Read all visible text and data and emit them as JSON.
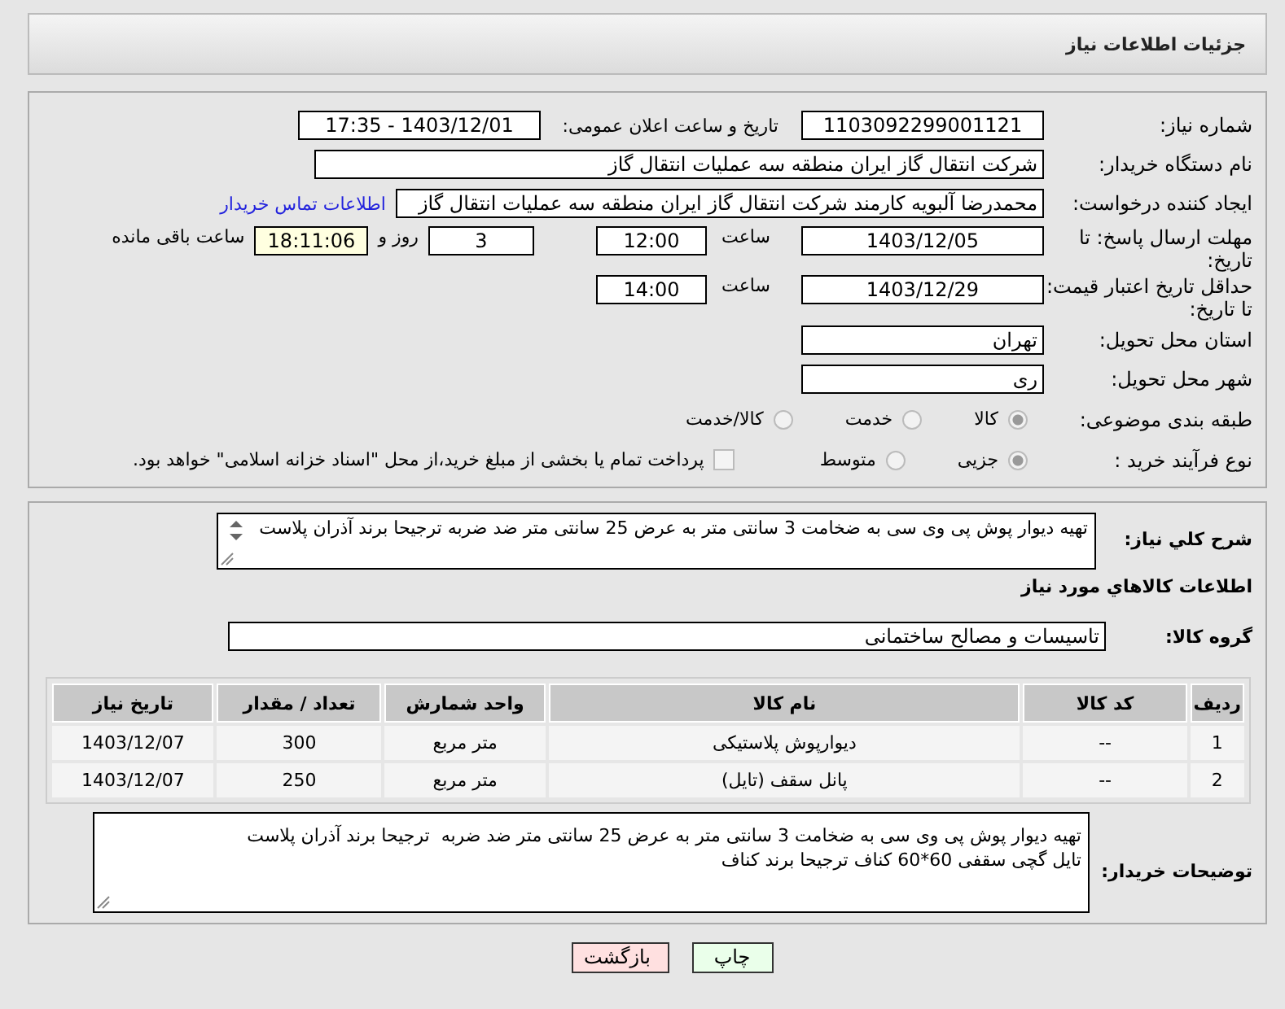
{
  "header": {
    "title": "جزئیات اطلاعات نیاز"
  },
  "details": {
    "need_number": {
      "label": "شماره نیاز:",
      "value": "1103092299001121"
    },
    "announce": {
      "label": "تاریخ و ساعت اعلان عمومی:",
      "value": "1403/12/01 - 17:35"
    },
    "buyer_org": {
      "label": "نام دستگاه خریدار:",
      "value": "شرکت انتقال گاز ایران منطقه سه عملیات انتقال گاز"
    },
    "requester": {
      "label": "ایجاد کننده درخواست:",
      "value": "محمدرضا آلبویه کارمند شرکت انتقال گاز ایران منطقه سه عملیات انتقال گاز",
      "link": "اطلاعات تماس خریدار"
    },
    "reply_deadline": {
      "label": "مهلت ارسال پاسخ: تا تاریخ:",
      "date": "1403/12/05",
      "time_label": "ساعت",
      "time": "12:00",
      "days": "3",
      "days_label": "روز و",
      "remaining": "18:11:06",
      "remaining_label": "ساعت باقی مانده"
    },
    "price_validity": {
      "label": "حداقل تاریخ اعتبار قیمت: تا تاریخ:",
      "date": "1403/12/29",
      "time_label": "ساعت",
      "time": "14:00"
    },
    "province": {
      "label": "استان محل تحویل:",
      "value": "تهران"
    },
    "city": {
      "label": "شهر محل تحویل:",
      "value": "ری"
    },
    "category": {
      "label": "طبقه بندی موضوعی:",
      "options": [
        {
          "label": "کالا",
          "selected": true
        },
        {
          "label": "خدمت",
          "selected": false
        },
        {
          "label": "کالا/خدمت",
          "selected": false
        }
      ]
    },
    "process": {
      "label": "نوع فرآیند خرید :",
      "options": [
        {
          "label": "جزیی",
          "selected": true
        },
        {
          "label": "متوسط",
          "selected": false
        }
      ],
      "payment": {
        "label": "پرداخت تمام یا بخشی از مبلغ خرید،از محل \"اسناد خزانه اسلامی\" خواهد بود.",
        "checked": false
      }
    }
  },
  "needs": {
    "description": {
      "label": "شرح کلي نیاز:",
      "value": "تهیه دیوار پوش پی وی سی به ضخامت 3 سانتی متر به عرض 25 سانتی متر ضد ضربه  ترجیحا برند آذران پلاست"
    },
    "goods_heading": "اطلاعات کالاهاي مورد نیاز",
    "group": {
      "label": "گروه کالا:",
      "value": "تاسیسات و مصالح ساختمانی"
    },
    "table": {
      "columns": [
        "ردیف",
        "کد کالا",
        "نام کالا",
        "واحد شمارش",
        "تعداد / مقدار",
        "تاریخ نیاز"
      ],
      "rows": [
        [
          "1",
          "--",
          "دیوارپوش پلاستیکی",
          "متر مربع",
          "300",
          "1403/12/07"
        ],
        [
          "2",
          "--",
          "پانل سقف (تایل)",
          "متر مربع",
          "250",
          "1403/12/07"
        ]
      ]
    },
    "notes": {
      "label": "توضیحات خریدار:",
      "value": "تهیه دیوار پوش پی وی سی به ضخامت 3 سانتی متر به عرض 25 سانتی متر ضد ضربه  ترجیحا برند آذران پلاست\nتایل گچی سقفی 60*60 کناف ترجیحا برند کناف"
    }
  },
  "buttons": [
    {
      "label": "چاپ",
      "kind": "print"
    },
    {
      "label": "بازگشت",
      "kind": "back"
    }
  ]
}
